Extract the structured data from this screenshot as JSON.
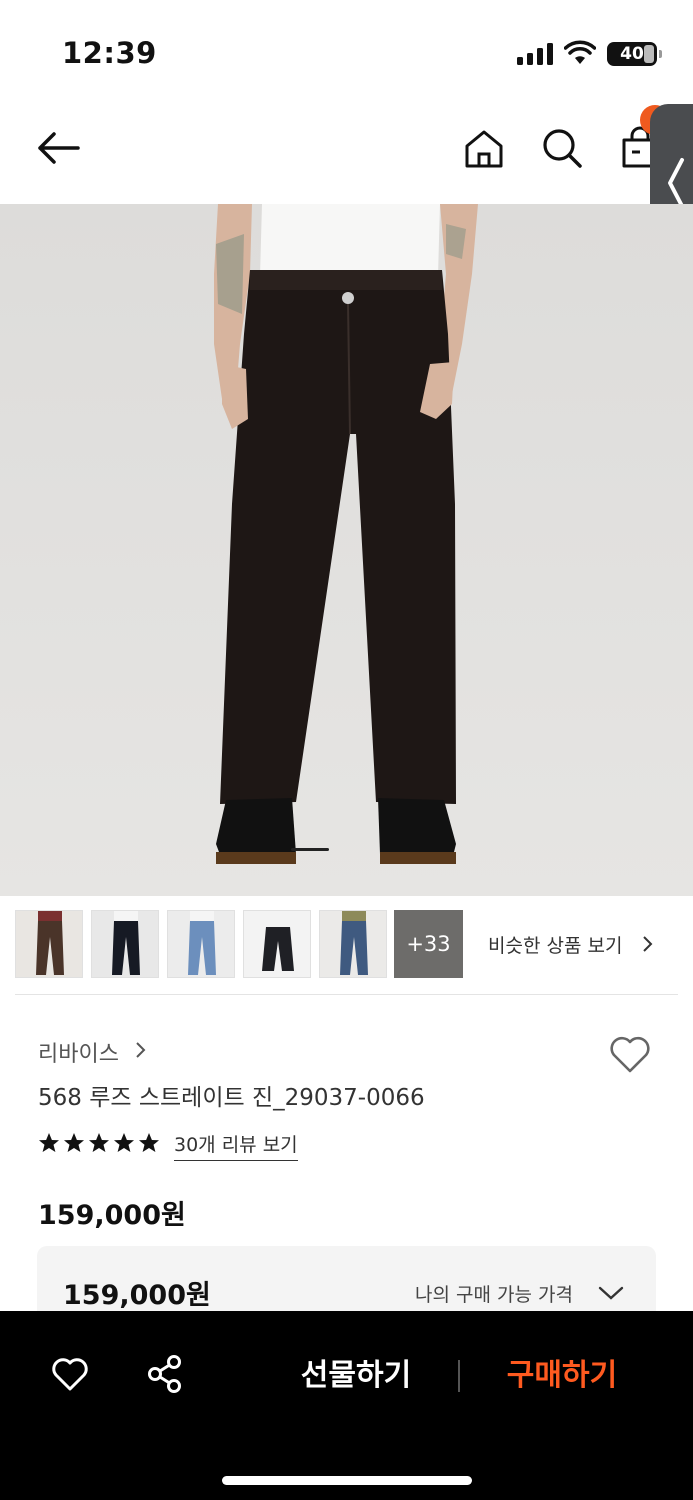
{
  "status_bar": {
    "time": "12:39",
    "battery": "40"
  },
  "nav": {
    "back": "back",
    "home": "home",
    "search": "search",
    "cart": "cart"
  },
  "colors": {
    "accent": "#ff5a1f",
    "badge": "#ef5a1f",
    "bottom_bar": "#000000"
  },
  "gallery": {
    "thumbnails": [
      "brown-jeans",
      "black-jeans",
      "light-blue-jeans",
      "black-jeans-flat",
      "mid-blue-jeans"
    ],
    "more_count": "+33",
    "similar_label": "비슷한 상품 보기"
  },
  "product": {
    "brand": "리바이스",
    "name": "568 루즈 스트레이트 진_29037-0066",
    "rating_stars": 5,
    "review_link": "30개 리뷰 보기",
    "price": "159,000원"
  },
  "price_box": {
    "price": "159,000원",
    "label": "나의 구매 가능 가격"
  },
  "bottom_bar": {
    "gift": "선물하기",
    "buy": "구매하기"
  }
}
